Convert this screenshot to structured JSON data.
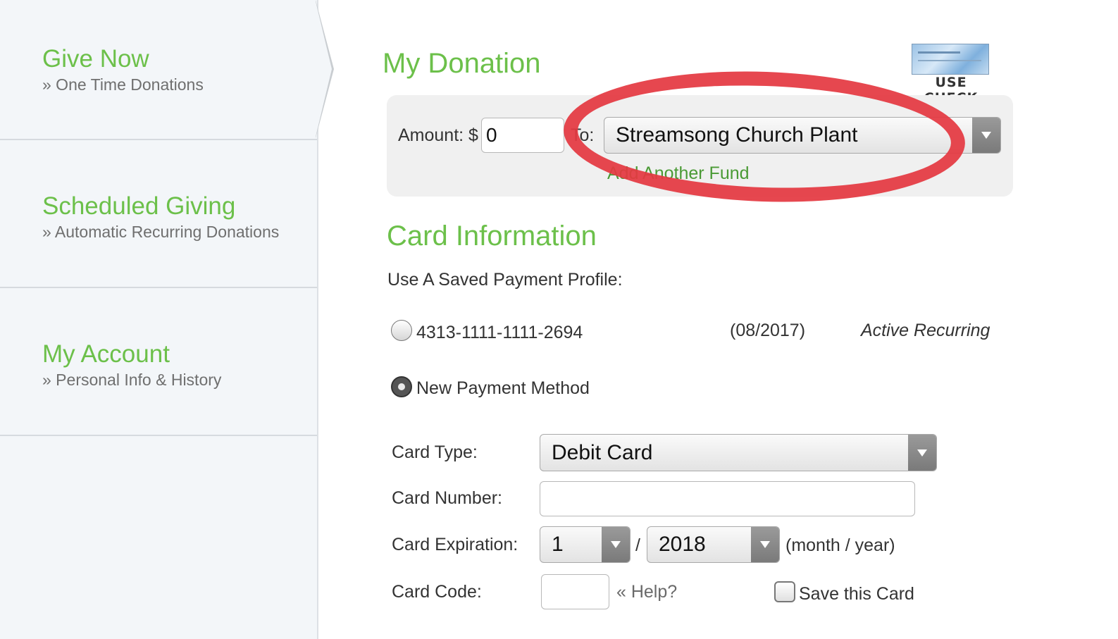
{
  "sidebar": {
    "items": [
      {
        "title": "Give Now",
        "subtitle": "» One Time Donations"
      },
      {
        "title": "Scheduled Giving",
        "subtitle": "» Automatic Recurring Donations"
      },
      {
        "title": "My Account",
        "subtitle": "» Personal Info & History"
      }
    ]
  },
  "donation": {
    "heading": "My Donation",
    "use_check_label": "USE CHECK",
    "amount_label": "Amount: $",
    "amount_value": "0",
    "to_label": "To:",
    "fund_value": "Streamsong Church Plant",
    "add_fund_link": "Add Another Fund"
  },
  "card": {
    "heading": "Card Information",
    "saved_profile_label": "Use A Saved Payment Profile:",
    "saved_profile": {
      "number": "4313-1111-1111-2694",
      "expiry": "(08/2017)",
      "status": "Active Recurring"
    },
    "new_method_label": "New Payment Method",
    "card_type_label": "Card Type:",
    "card_type_value": "Debit Card",
    "card_number_label": "Card Number:",
    "card_number_value": "",
    "expiration_label": "Card Expiration:",
    "exp_month": "1",
    "exp_separator": "/",
    "exp_year": "2018",
    "exp_hint": "(month / year)",
    "card_code_label": "Card Code:",
    "card_code_value": "",
    "help_link": "« Help?",
    "save_card_label": "Save this Card"
  },
  "colors": {
    "accent_green": "#6cc04a",
    "annotation_red": "#e43942"
  }
}
